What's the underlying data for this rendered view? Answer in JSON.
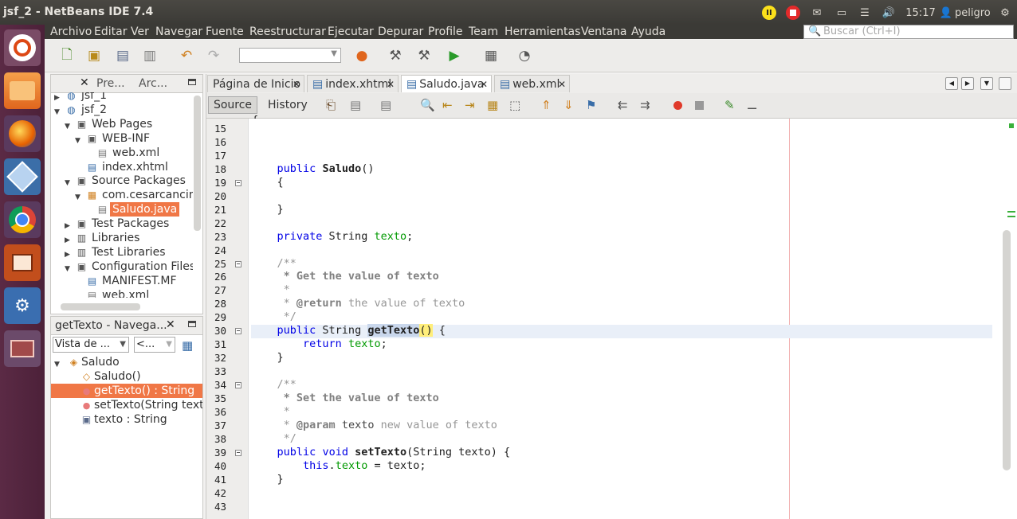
{
  "window": {
    "title": "jsf_2 - NetBeans IDE 7.4"
  },
  "tray": {
    "time": "15:17",
    "user": "peligro"
  },
  "menu": [
    "Archivo",
    "Editar",
    "Ver",
    "Navegar",
    "Fuente",
    "Reestructurar",
    "Ejecutar",
    "Depurar",
    "Profile",
    "Team",
    "Herramientas",
    "Ventana",
    "Ayuda"
  ],
  "search": {
    "placeholder": "Buscar (Ctrl+I)"
  },
  "launcher": [
    "ubuntu-dash-icon",
    "files-icon",
    "firefox-icon",
    "virtualbox-icon",
    "chrome-icon",
    "presentation-icon",
    "settings-icon",
    "workspace-icon"
  ],
  "projects_panel": {
    "tabs": [
      "Pre...",
      "Arc..."
    ],
    "tree": [
      {
        "label": "jsf_1",
        "level": 0,
        "arrow": "right",
        "icon": "globe-icon"
      },
      {
        "label": "jsf_2",
        "level": 0,
        "arrow": "down",
        "icon": "globe-icon"
      },
      {
        "label": "Web Pages",
        "level": 1,
        "arrow": "down",
        "icon": "web-folder-icon"
      },
      {
        "label": "WEB-INF",
        "level": 2,
        "arrow": "down",
        "icon": "web-folder-icon"
      },
      {
        "label": "web.xml",
        "level": 3,
        "arrow": "",
        "icon": "xml-file-icon"
      },
      {
        "label": "index.xhtml",
        "level": 2,
        "arrow": "",
        "icon": "xhtml-file-icon"
      },
      {
        "label": "Source Packages",
        "level": 1,
        "arrow": "down",
        "icon": "source-folder-icon"
      },
      {
        "label": "com.cesarcancino",
        "level": 2,
        "arrow": "down",
        "icon": "package-icon"
      },
      {
        "label": "Saludo.java",
        "level": 3,
        "arrow": "",
        "icon": "java-file-icon",
        "selected": true
      },
      {
        "label": "Test Packages",
        "level": 1,
        "arrow": "right",
        "icon": "test-folder-icon"
      },
      {
        "label": "Libraries",
        "level": 1,
        "arrow": "right",
        "icon": "library-icon"
      },
      {
        "label": "Test Libraries",
        "level": 1,
        "arrow": "right",
        "icon": "library-icon"
      },
      {
        "label": "Configuration Files",
        "level": 1,
        "arrow": "down",
        "icon": "config-folder-icon"
      },
      {
        "label": "MANIFEST.MF",
        "level": 2,
        "arrow": "",
        "icon": "manifest-file-icon"
      },
      {
        "label": "web.xml",
        "level": 2,
        "arrow": "",
        "icon": "xml-file-icon"
      }
    ]
  },
  "navigator_panel": {
    "title": "getTexto - Navega...",
    "filter_select": "Vista de ...",
    "filter_select2": "<...",
    "tree": [
      {
        "label": "Saludo",
        "level": 0,
        "arrow": "down",
        "icon": "class-icon"
      },
      {
        "label": "Saludo()",
        "level": 1,
        "icon": "constructor-icon"
      },
      {
        "label": "getTexto() : String",
        "level": 1,
        "icon": "method-icon",
        "selected": true
      },
      {
        "label": "setTexto(String texto)",
        "level": 1,
        "icon": "method-icon"
      },
      {
        "label": "texto : String",
        "level": 1,
        "icon": "field-icon"
      }
    ]
  },
  "editor": {
    "tabs": [
      {
        "label": "Página de Inicio",
        "active": false
      },
      {
        "label": "index.xhtml",
        "active": false
      },
      {
        "label": "Saludo.java",
        "active": true
      },
      {
        "label": "web.xml",
        "active": false
      }
    ],
    "view_tabs": [
      "Source",
      "History"
    ],
    "lines": [
      {
        "n": "15",
        "text": ""
      },
      {
        "n": "16",
        "text": ""
      },
      {
        "n": "17",
        "text": ""
      },
      {
        "n": "18",
        "text": "    public Saludo()"
      },
      {
        "n": "19",
        "text": "    {"
      },
      {
        "n": "20",
        "text": ""
      },
      {
        "n": "21",
        "text": "    }"
      },
      {
        "n": "22",
        "text": ""
      },
      {
        "n": "23",
        "text": "    private String texto;"
      },
      {
        "n": "24",
        "text": ""
      },
      {
        "n": "25",
        "text": "    /**"
      },
      {
        "n": "26",
        "text": "     * Get the value of texto"
      },
      {
        "n": "27",
        "text": "     *"
      },
      {
        "n": "28",
        "text": "     * @return the value of texto"
      },
      {
        "n": "29",
        "text": "     */"
      },
      {
        "n": "30",
        "text": "    public String getTexto() {"
      },
      {
        "n": "31",
        "text": "        return texto;"
      },
      {
        "n": "32",
        "text": "    }"
      },
      {
        "n": "33",
        "text": ""
      },
      {
        "n": "34",
        "text": "    /**"
      },
      {
        "n": "35",
        "text": "     * Set the value of texto"
      },
      {
        "n": "36",
        "text": "     *"
      },
      {
        "n": "37",
        "text": "     * @param texto new value of texto"
      },
      {
        "n": "38",
        "text": "     */"
      },
      {
        "n": "39",
        "text": "    public void setTexto(String texto) {"
      },
      {
        "n": "40",
        "text": "        this.texto = texto;"
      },
      {
        "n": "41",
        "text": "    }"
      },
      {
        "n": "42",
        "text": ""
      },
      {
        "n": "43",
        "text": ""
      }
    ]
  },
  "colors": {
    "accent_orange": "#f07746",
    "selection": "#c9d7ec",
    "launcher_bg": "#5b2a45",
    "current_line": "#e9eff8"
  }
}
